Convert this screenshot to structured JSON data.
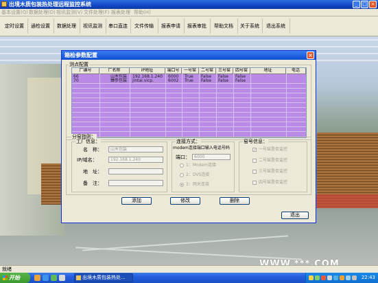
{
  "window": {
    "title": "出境木质包装热处理远程监控系统"
  },
  "menu": [
    "基本设置(Q)",
    "数据处理(D)",
    "视讯监测(V)",
    "文件处理(F)",
    "报表处理",
    "帮助(H)"
  ],
  "toolbar": [
    "定时设置",
    "通检设置",
    "数据处理",
    "视讯监测",
    "串口直连",
    "文件传输",
    "报表申请",
    "报表审批",
    "帮助文档",
    "关于系统",
    "退出系统"
  ],
  "dialog": {
    "title": "箱检参数配置",
    "grid_group": "测点配置",
    "columns": [
      "厂编号",
      "厂名称",
      "IP地址",
      "端口号",
      "一号窑",
      "二号窑",
      "三号窑",
      "四号窑",
      "地址",
      "电话"
    ],
    "rows": [
      [
        "66",
        "山木包装",
        "192.168.1.240",
        "6000",
        "True",
        "False",
        "False",
        "False",
        "",
        ""
      ],
      [
        "70",
        "臻参包装",
        "jintai.vicp.",
        "6002",
        "True",
        "False",
        "False",
        "False",
        "",
        ""
      ]
    ],
    "assign": {
      "group": "分窑指则：",
      "factory_group": "工厂信息：",
      "name_label": "名　称：",
      "name_value": "山木包装",
      "ip_label": "IP/域名：",
      "ip_value": "192.168.1.240",
      "address_label": "地　址：",
      "address_value": "",
      "note_label": "备　注：",
      "note_value": ""
    },
    "connect": {
      "group": "连接方式：",
      "note": "modem连接端口输入电话号码",
      "port_label": "端口：",
      "port_value": "6000",
      "options": [
        "1：Modem连接",
        "2：DVS连接",
        "3：网关连接"
      ],
      "selected": 2
    },
    "kiln": {
      "group": "窑号信息：",
      "items": [
        "一号窑是否监控",
        "二号窑是否监控",
        "三号窑是否监控",
        "四号窑是否监控"
      ],
      "checked": [
        true,
        false,
        false,
        false
      ]
    },
    "buttons": {
      "add": "添加",
      "edit": "修改",
      "delete": "删除",
      "exit": "退出"
    }
  },
  "status": {
    "text": "就绪"
  },
  "taskbar": {
    "start": "开始",
    "task": "出境木质包装热处...",
    "clock": "22:43"
  },
  "watermark": "WWW.***.COM",
  "colors": {
    "grid_bg": "#b98ae6",
    "title_blue": "#0d4dd1",
    "dialog_bg": "#ece9d8"
  }
}
